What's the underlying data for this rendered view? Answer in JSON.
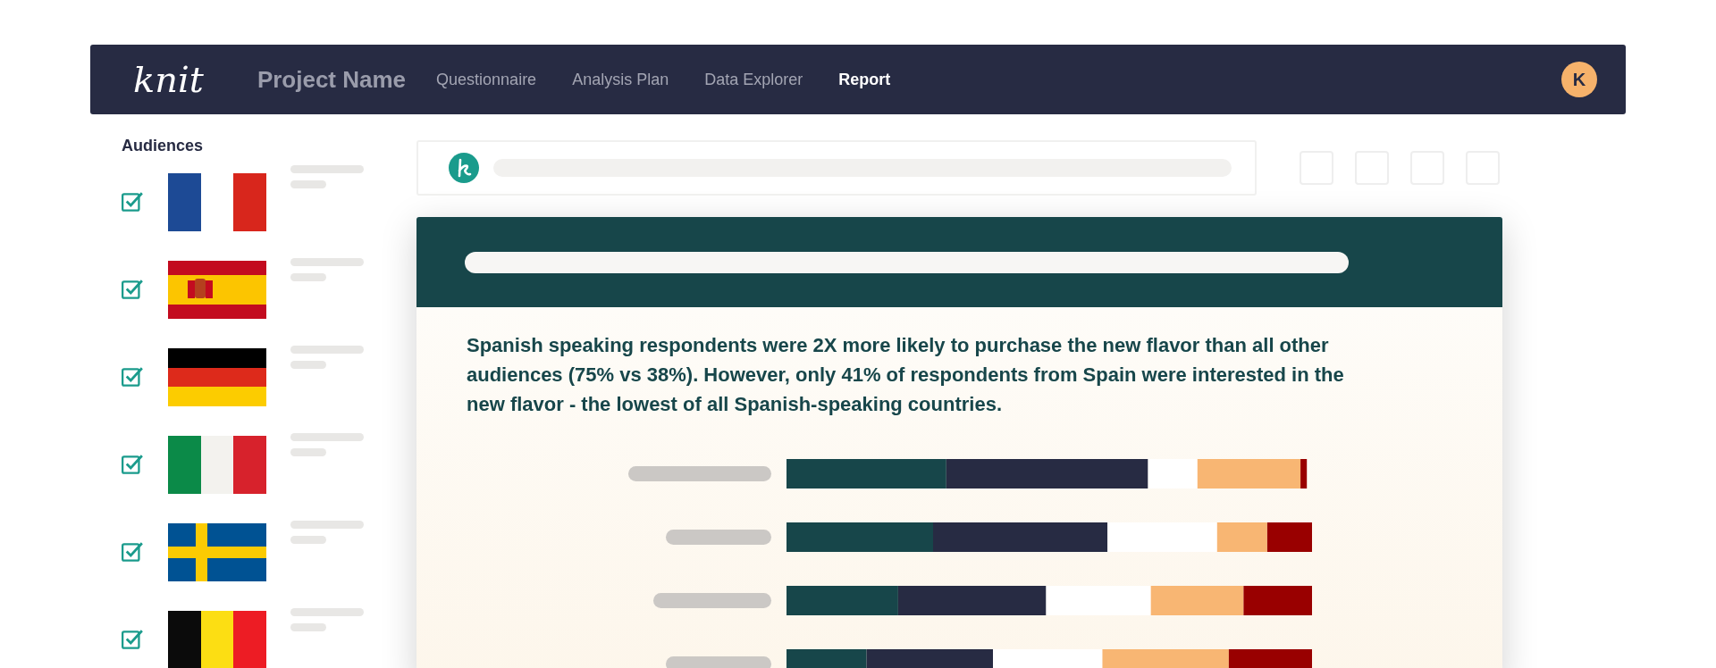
{
  "navbar": {
    "logo": "knit",
    "project_name": "Project Name",
    "tabs": [
      {
        "label": "Questionnaire",
        "selected": false
      },
      {
        "label": "Analysis Plan",
        "selected": false
      },
      {
        "label": "Data Explorer",
        "selected": false
      },
      {
        "label": "Report",
        "selected": true
      }
    ],
    "avatar": "K"
  },
  "sidebar": {
    "title": "Audiences",
    "audiences": [
      {
        "kind": "france",
        "checked": true
      },
      {
        "kind": "spain",
        "checked": true
      },
      {
        "kind": "germany",
        "checked": true
      },
      {
        "kind": "italy",
        "checked": true
      },
      {
        "kind": "sweden",
        "checked": true
      },
      {
        "kind": "belgium",
        "checked": true
      }
    ]
  },
  "report": {
    "insight": "Spanish speaking respondents were 2X more likely to purchase the new flavor than all other audiences (75% vs 38%). However, only 41% of respondents from Spain were interested in the new flavor - the lowest of all Spanish-speaking countries."
  }
}
